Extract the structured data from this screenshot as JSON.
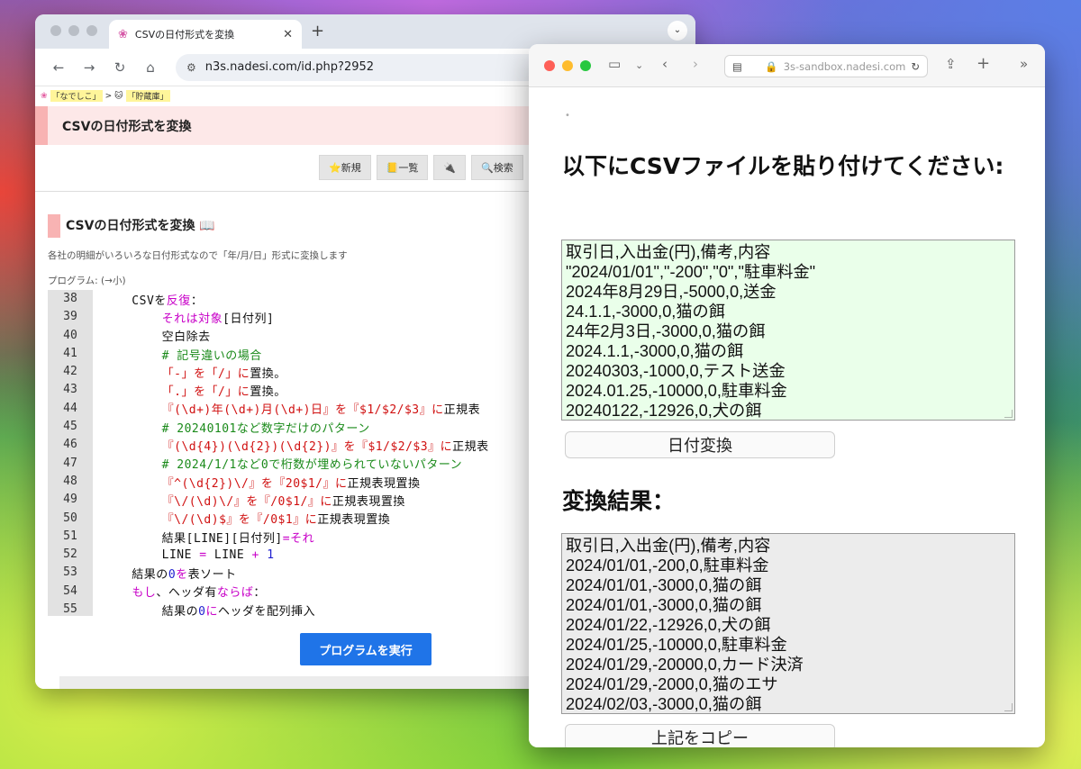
{
  "chrome": {
    "tab_title": "CSVの日付形式を変換",
    "new_tab_symbol": "+",
    "url": "n3s.nadesi.com/id.php?2952",
    "breadcrumb": [
      "「なでしこ」",
      ">",
      "「貯蔵庫」"
    ],
    "title": "CSVの日付形式を変換",
    "buttons": [
      "⭐新規",
      "📒一覧",
      "🔌",
      "🔍検索"
    ],
    "heading": "CSVの日付形式を変換 📖",
    "description": "各社の明細がいろいろな日付形式なので「年/月/日」形式に変換します",
    "program_label": "プログラム: (→小)",
    "run_button": "プログラムを実行",
    "code_lines": [
      {
        "n": "38",
        "segs": [
          {
            "t": "    CSVを",
            "c": "n"
          },
          {
            "t": "反復",
            "c": "k"
          },
          {
            "t": "：",
            "c": "n"
          }
        ]
      },
      {
        "n": "39",
        "segs": [
          {
            "t": "        ",
            "c": "n"
          },
          {
            "t": "それは",
            "c": "k"
          },
          {
            "t": "対象",
            "c": "k"
          },
          {
            "t": "[日付列]",
            "c": "n"
          }
        ]
      },
      {
        "n": "40",
        "segs": [
          {
            "t": "        空白除去",
            "c": "n"
          }
        ]
      },
      {
        "n": "41",
        "segs": [
          {
            "t": "        # 記号違いの場合",
            "c": "c"
          }
        ]
      },
      {
        "n": "42",
        "segs": [
          {
            "t": "        「-」を「/」に",
            "c": "s"
          },
          {
            "t": "置換。",
            "c": "n"
          }
        ]
      },
      {
        "n": "43",
        "segs": [
          {
            "t": "        「.」を「/」に",
            "c": "s"
          },
          {
            "t": "置換。",
            "c": "n"
          }
        ]
      },
      {
        "n": "44",
        "segs": [
          {
            "t": "        『(\\d+)年(\\d+)月(\\d+)日』を『$1/$2/$3』に",
            "c": "s"
          },
          {
            "t": "正規表",
            "c": "n"
          }
        ]
      },
      {
        "n": "45",
        "segs": [
          {
            "t": "        # 20240101など数字だけのパターン",
            "c": "c"
          }
        ]
      },
      {
        "n": "46",
        "segs": [
          {
            "t": "        『(\\d{4})(\\d{2})(\\d{2})』を『$1/$2/$3』に",
            "c": "s"
          },
          {
            "t": "正規表",
            "c": "n"
          }
        ]
      },
      {
        "n": "47",
        "segs": [
          {
            "t": "        # 2024/1/1など0で桁数が埋められていないパターン",
            "c": "c"
          }
        ]
      },
      {
        "n": "48",
        "segs": [
          {
            "t": "        『^(\\d{2})\\/』を『20$1/』に",
            "c": "s"
          },
          {
            "t": "正規表現置換",
            "c": "n"
          }
        ]
      },
      {
        "n": "49",
        "segs": [
          {
            "t": "        『\\/(\\d)\\/』を『/0$1/』に",
            "c": "s"
          },
          {
            "t": "正規表現置換",
            "c": "n"
          }
        ]
      },
      {
        "n": "50",
        "segs": [
          {
            "t": "        『\\/(\\d)$』を『/0$1』に",
            "c": "s"
          },
          {
            "t": "正規表現置換",
            "c": "n"
          }
        ]
      },
      {
        "n": "51",
        "segs": [
          {
            "t": "        結果[LINE][日付列]",
            "c": "n"
          },
          {
            "t": "=",
            "c": "k"
          },
          {
            "t": "それ",
            "c": "k"
          }
        ]
      },
      {
        "n": "52",
        "segs": [
          {
            "t": "        LINE ",
            "c": "n"
          },
          {
            "t": "=",
            "c": "k"
          },
          {
            "t": " LINE ",
            "c": "n"
          },
          {
            "t": "+",
            "c": "k"
          },
          {
            "t": " 1",
            "c": "b"
          }
        ]
      },
      {
        "n": "53",
        "segs": [
          {
            "t": "    結果の",
            "c": "n"
          },
          {
            "t": "0",
            "c": "b"
          },
          {
            "t": "を",
            "c": "k"
          },
          {
            "t": "表ソート",
            "c": "n"
          }
        ]
      },
      {
        "n": "54",
        "segs": [
          {
            "t": "    ",
            "c": "n"
          },
          {
            "t": "もし",
            "c": "k"
          },
          {
            "t": "、ヘッダ有",
            "c": "n"
          },
          {
            "t": "ならば",
            "c": "k"
          },
          {
            "t": "：",
            "c": "n"
          }
        ]
      },
      {
        "n": "55",
        "segs": [
          {
            "t": "        結果の",
            "c": "n"
          },
          {
            "t": "0",
            "c": "b"
          },
          {
            "t": "に",
            "c": "k"
          },
          {
            "t": "ヘッダを配列挿入",
            "c": "n"
          }
        ]
      }
    ]
  },
  "safari": {
    "url": "3s-sandbox.nadesi.com",
    "dot": "•",
    "heading1": "以下にCSVファイルを貼り付けてください:",
    "input_lines": [
      "取引日,入出金(円),備考,内容",
      "\"2024/01/01\",\"-200\",\"0\",\"駐車料金\"",
      "2024年8月29日,-5000,0,送金",
      "24.1.1,-3000,0,猫の餌",
      "24年2月3日,-3000,0,猫の餌",
      "2024.1.1,-3000,0,猫の餌",
      "20240303,-1000,0,テスト送金",
      "2024.01.25,-10000,0,駐車料金",
      "20240122,-12926,0,犬の餌"
    ],
    "convert_button": "日付変換",
    "heading2": "変換結果：",
    "output_lines": [
      "取引日,入出金(円),備考,内容",
      "2024/01/01,-200,0,駐車料金",
      "2024/01/01,-3000,0,猫の餌",
      "2024/01/01,-3000,0,猫の餌",
      "2024/01/22,-12926,0,犬の餌",
      "2024/01/25,-10000,0,駐車料金",
      "2024/01/29,-20000,0,カード決済",
      "2024/01/29,-2000,0,猫のエサ",
      "2024/02/03,-3000,0,猫の餌"
    ],
    "copy_button": "上記をコピー"
  }
}
